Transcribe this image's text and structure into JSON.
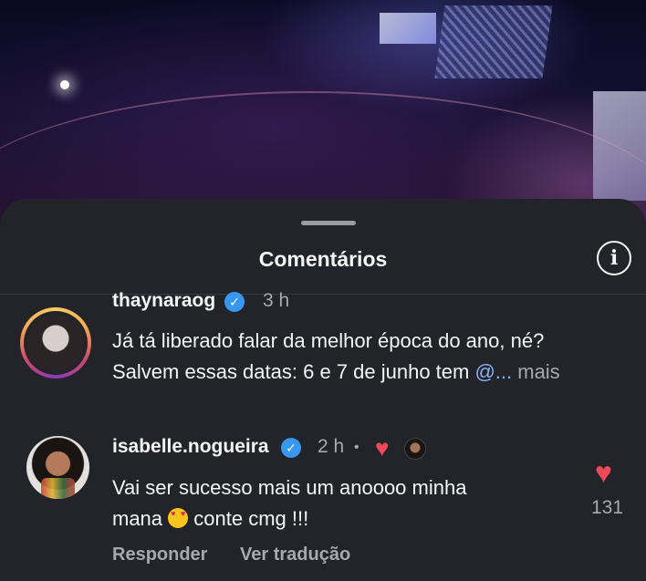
{
  "sheet": {
    "title": "Comentários"
  },
  "comments": [
    {
      "username": "thaynaraog",
      "verified": true,
      "time": "3 h",
      "text_line1": "Já tá liberado falar da melhor época do ano, né?",
      "text_line2_prefix": "Salvem essas datas: 6 e 7 de junho tem ",
      "mention": "@...",
      "more_label": " mais"
    },
    {
      "username": "isabelle.nogueira",
      "verified": true,
      "time": "2 h",
      "separator": "•",
      "text_line1": "Vai ser sucesso mais um anoooo minha",
      "text_line2_prefix": "mana ",
      "text_line2_suffix": " conte cmg !!!",
      "like_count": "131",
      "reply_label": "Responder",
      "translate_label": "Ver tradução"
    }
  ],
  "icons": {
    "verified": "verified-badge-icon",
    "info": "info-icon",
    "heart": "heart-icon",
    "emoji": "heart-eyes-emoji"
  },
  "colors": {
    "sheet_bg": "#22242a",
    "verified_blue": "#3897f0",
    "heart_red": "#ed4956",
    "mention_blue": "#8ab4f8"
  }
}
